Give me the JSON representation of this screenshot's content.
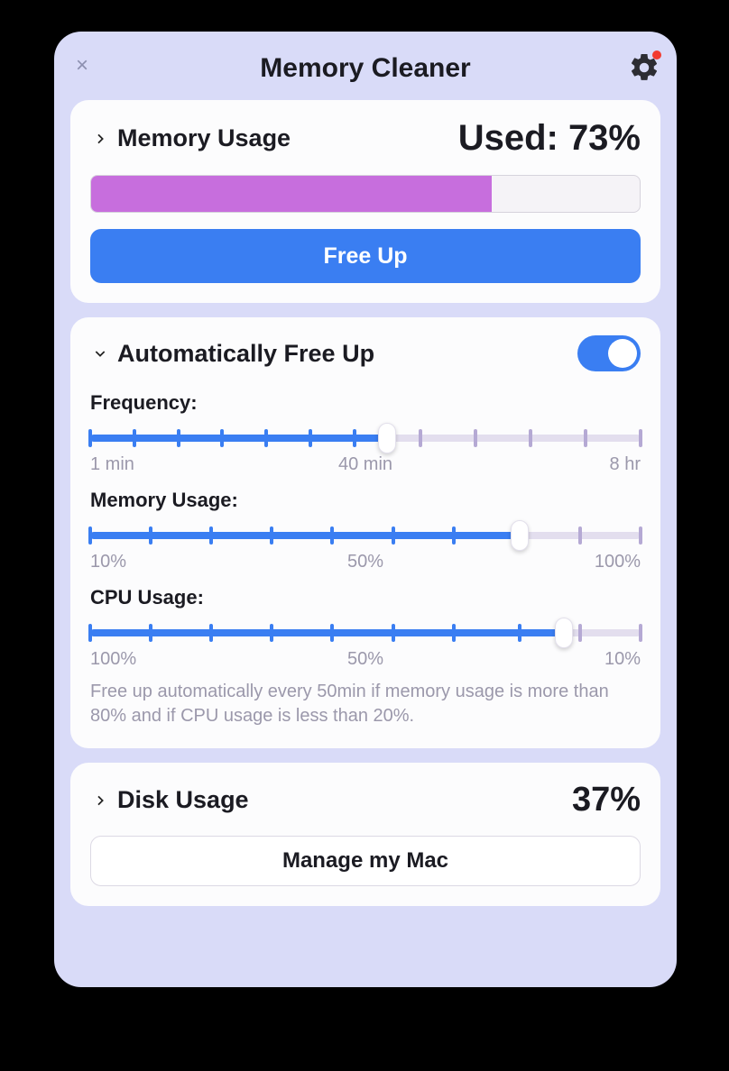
{
  "header": {
    "title": "Memory Cleaner"
  },
  "memory": {
    "section_label": "Memory Usage",
    "used_prefix": "Used: ",
    "used_percent": 73,
    "freeup_label": "Free Up"
  },
  "auto": {
    "section_label": "Automatically Free Up",
    "toggle_on": true,
    "sliders": {
      "frequency": {
        "label": "Frequency:",
        "left": "1 min",
        "mid": "40 min",
        "right": "8 hr",
        "fill_pct": 54,
        "thumb_pct": 54,
        "ticks": [
          0,
          8,
          16,
          24,
          32,
          40,
          48,
          60,
          70,
          80,
          90,
          100
        ],
        "ticks_on_upto": 48
      },
      "memory": {
        "label": "Memory Usage:",
        "left": "10%",
        "mid": "50%",
        "right": "100%",
        "fill_pct": 78,
        "thumb_pct": 78,
        "ticks": [
          0,
          11,
          22,
          33,
          44,
          55,
          66,
          78,
          89,
          100
        ],
        "ticks_on_upto": 78
      },
      "cpu": {
        "label": "CPU Usage:",
        "left": "100%",
        "mid": "50%",
        "right": "10%",
        "fill_pct": 86,
        "thumb_pct": 86,
        "ticks": [
          0,
          11,
          22,
          33,
          44,
          55,
          66,
          78,
          89,
          100
        ],
        "ticks_on_upto": 86
      }
    },
    "summary": "Free up automatically every 50min if memory usage is more than 80% and if CPU usage is less than 20%."
  },
  "disk": {
    "section_label": "Disk Usage",
    "percent": 37,
    "manage_label": "Manage my Mac"
  }
}
